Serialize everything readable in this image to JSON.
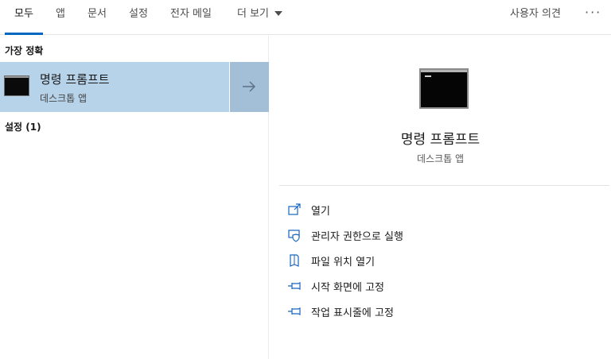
{
  "tabs": [
    {
      "label": "모두",
      "active": true
    },
    {
      "label": "앱"
    },
    {
      "label": "문서"
    },
    {
      "label": "설정"
    },
    {
      "label": "전자 메일"
    },
    {
      "label": "더 보기"
    }
  ],
  "header": {
    "feedback_label": "사용자 의견",
    "more_label": "···"
  },
  "left": {
    "best_match_heading": "가장 정확",
    "best_match": {
      "title": "명령 프롬프트",
      "subtitle": "데스크톱 앱",
      "icon": "command-prompt-icon"
    },
    "settings_heading": "설정 (1)"
  },
  "detail": {
    "title": "명령 프롬프트",
    "subtitle": "데스크톱 앱",
    "actions": [
      {
        "label": "열기",
        "icon": "open-icon"
      },
      {
        "label": "관리자 권한으로 실행",
        "icon": "shield-icon"
      },
      {
        "label": "파일 위치 열기",
        "icon": "file-location-icon"
      },
      {
        "label": "시작 화면에 고정",
        "icon": "pin-icon"
      },
      {
        "label": "작업 표시줄에 고정",
        "icon": "pin-icon"
      }
    ]
  },
  "colors": {
    "accent": "#0067c0",
    "selection": "#b7d3ea",
    "selection_arrow": "#a3bfd8",
    "action_icon": "#1565c0"
  }
}
